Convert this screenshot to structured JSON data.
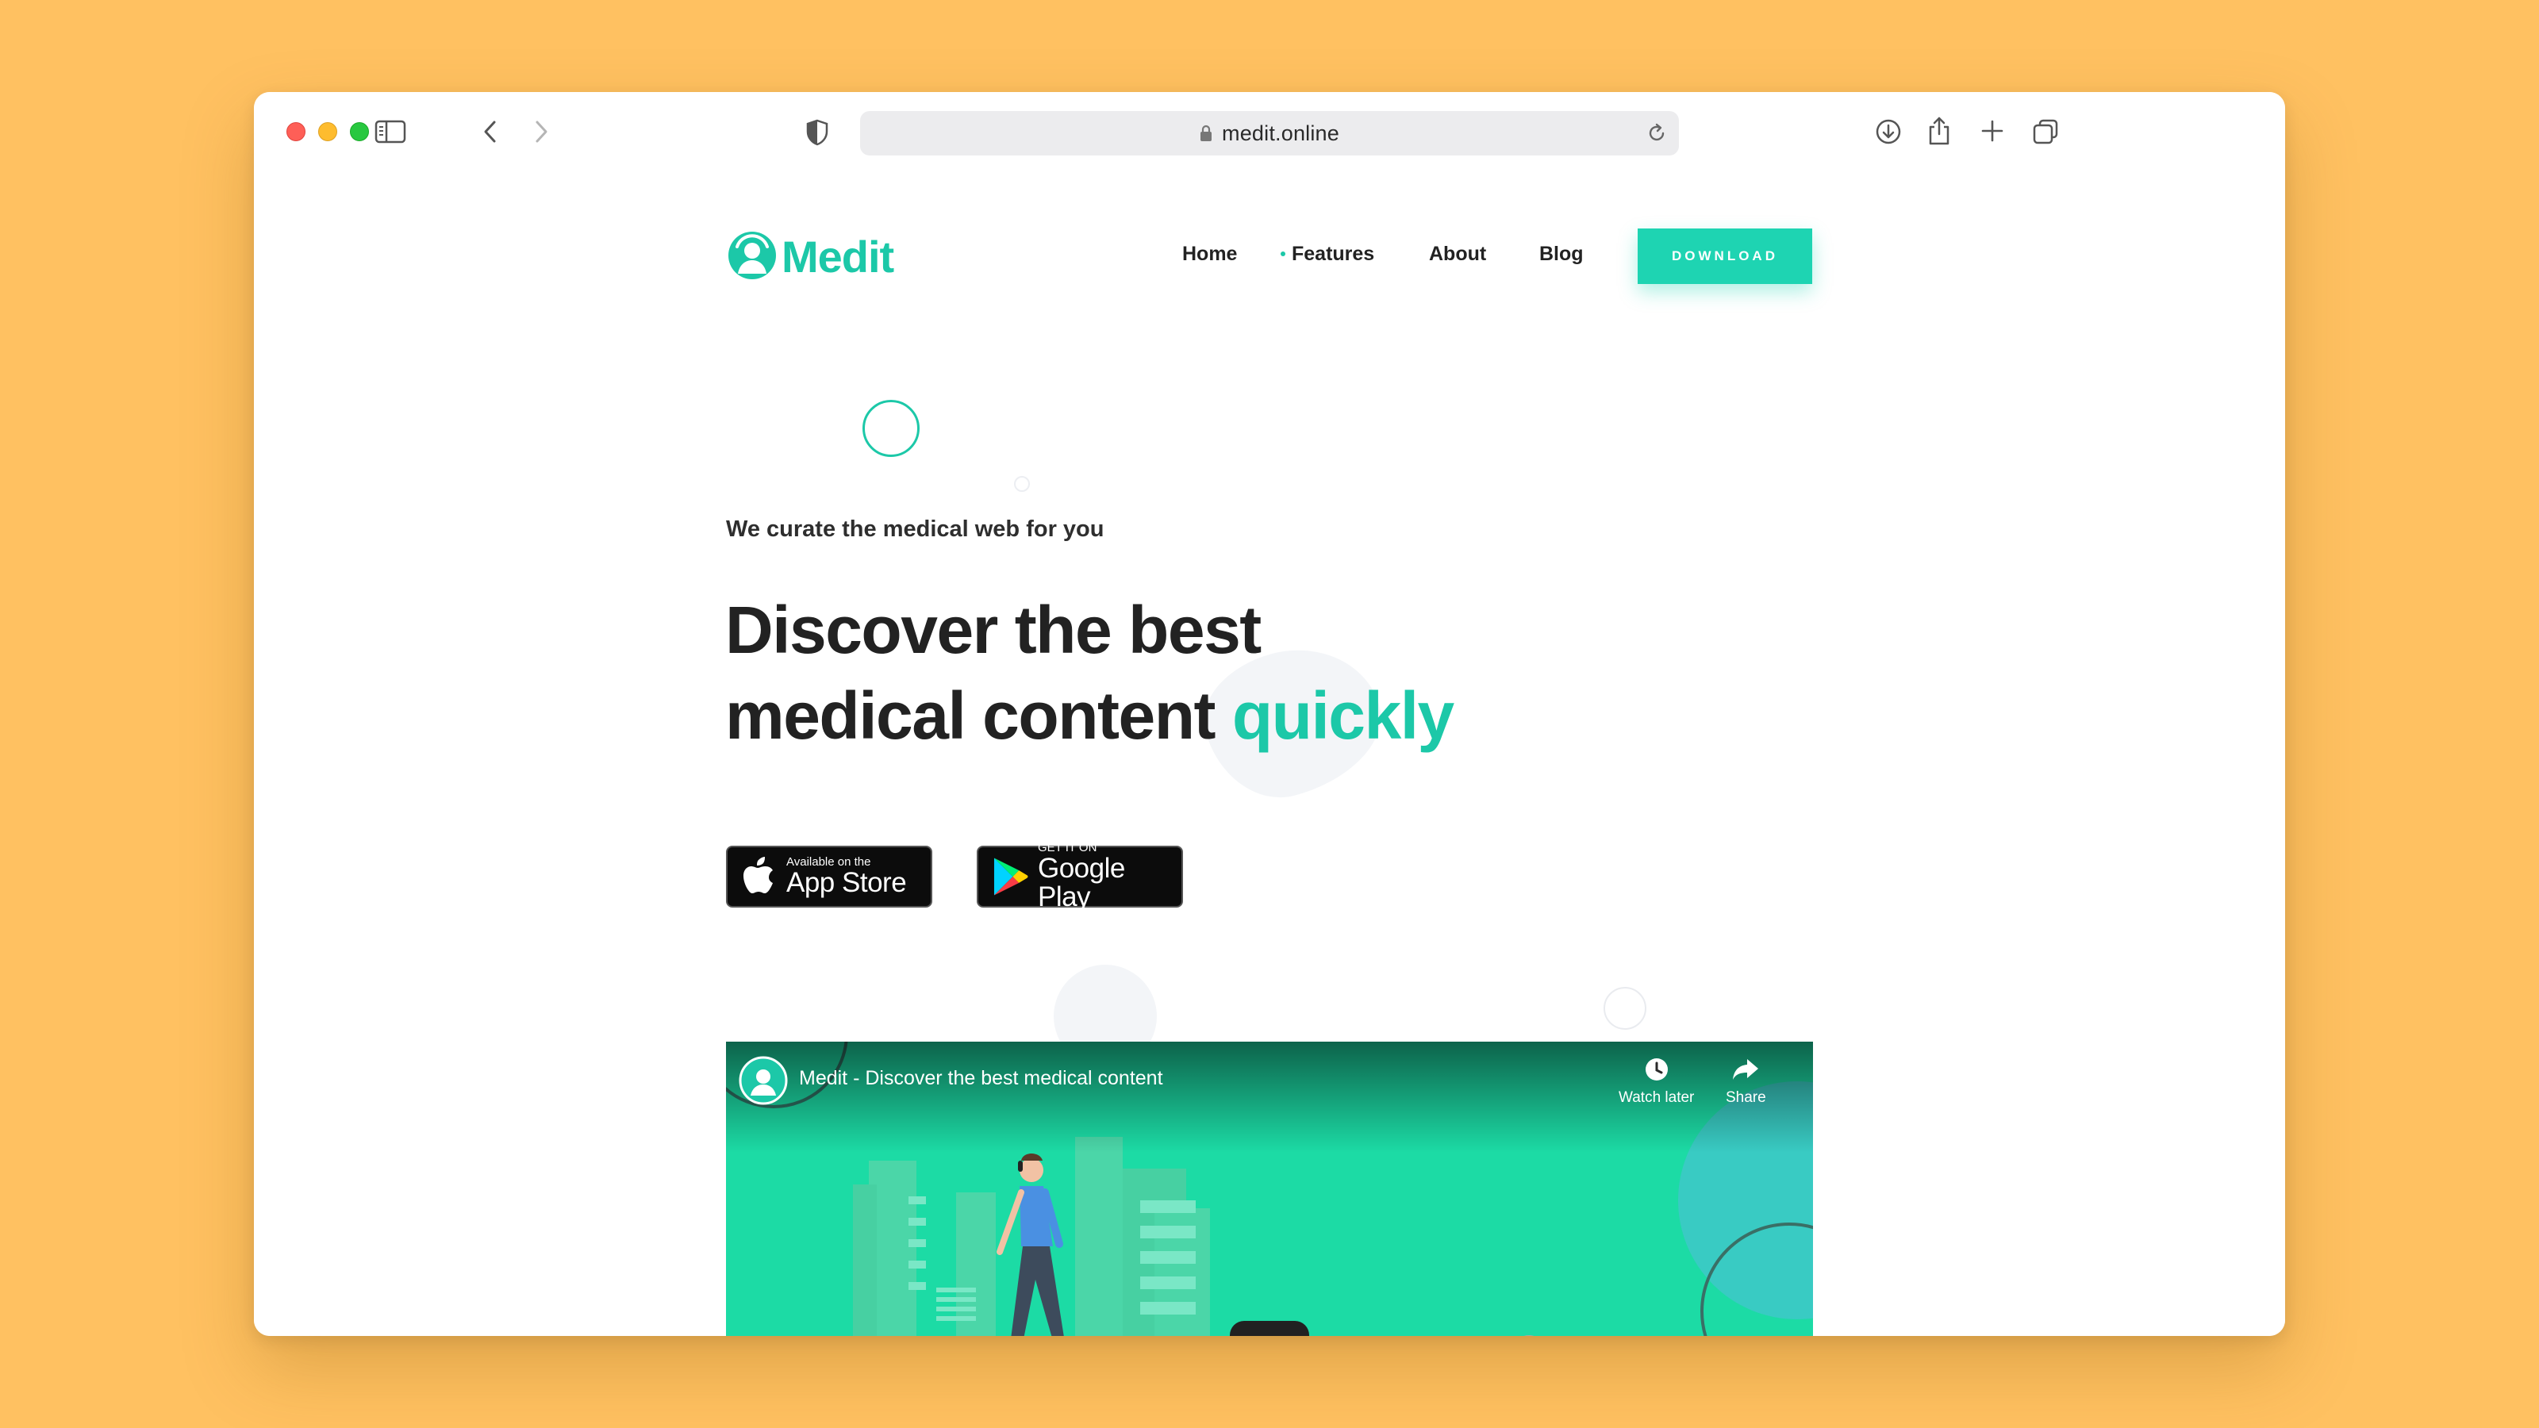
{
  "browser": {
    "url": "medit.online",
    "traffic_lights": [
      "close",
      "minimize",
      "zoom"
    ]
  },
  "site": {
    "logo_text": "Medit",
    "nav": {
      "home": "Home",
      "features": "Features",
      "about": "About",
      "blog": "Blog",
      "download": "DOWNLOAD"
    },
    "hero": {
      "tagline": "We curate the medical web for you",
      "headline_line1": "Discover the best",
      "headline_line2": "medical content",
      "headline_accent": "quickly"
    },
    "stores": {
      "app_store_small": "Available on the",
      "app_store_big": "App Store",
      "google_small": "GET IT ON",
      "google_big": "Google Play"
    },
    "video": {
      "title": "Medit - Discover the best medical content",
      "watch_later": "Watch later",
      "share": "Share"
    }
  },
  "colors": {
    "background": "#ffc161",
    "brand": "#1cc8a8",
    "video_bg": "#1cdba5"
  }
}
